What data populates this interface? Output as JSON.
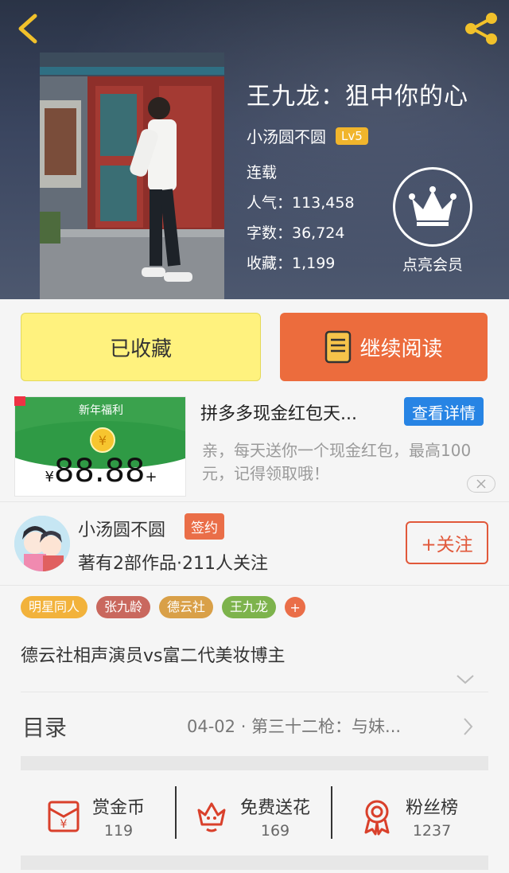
{
  "header": {
    "title": "王九龙：狙中你的心",
    "author": "小汤圆不圆",
    "level": "Lv5",
    "status": "连载",
    "popularity": "人气：113,458",
    "word_count": "字数：36,724",
    "favorites": "收藏：1,199",
    "vip_label": "点亮会员"
  },
  "actions": {
    "collected_label": "已收藏",
    "continue_label": "继续阅读"
  },
  "ad": {
    "banner_heading": "新年福利",
    "coin_symbol": "¥",
    "amount_prefix": "¥",
    "amount": "88.88",
    "amount_suffix": "+",
    "title": "拼多多现金红包天...",
    "detail_button": "查看详情",
    "description": "亲，每天送你一个现金红包，最高100元，记得领取哦！"
  },
  "author_card": {
    "name": "小汤圆不圆",
    "badge": "签约",
    "meta": "著有2部作品·211人关注",
    "follow_label": "+关注"
  },
  "tags": [
    {
      "label": "明星同人",
      "color": "#f2b23b"
    },
    {
      "label": "张九龄",
      "color": "#c9685e"
    },
    {
      "label": "德云社",
      "color": "#d9a048"
    },
    {
      "label": "王九龙",
      "color": "#7db34c"
    }
  ],
  "tag_more": "+",
  "intro": "德云社相声演员vs富二代美妆博主",
  "toc": {
    "title": "目录",
    "latest": "04-02 · 第三十二枪：与妹..."
  },
  "stats": {
    "reward": {
      "label": "赏金币",
      "value": "119"
    },
    "flowers": {
      "label": "免费送花",
      "value": "169"
    },
    "fans": {
      "label": "粉丝榜",
      "value": "1237"
    }
  },
  "colors": {
    "accent_orange": "#ec6c3d",
    "collected_yellow": "#fff27e",
    "link_blue": "#2784e4",
    "icon_red": "#d9402b"
  }
}
